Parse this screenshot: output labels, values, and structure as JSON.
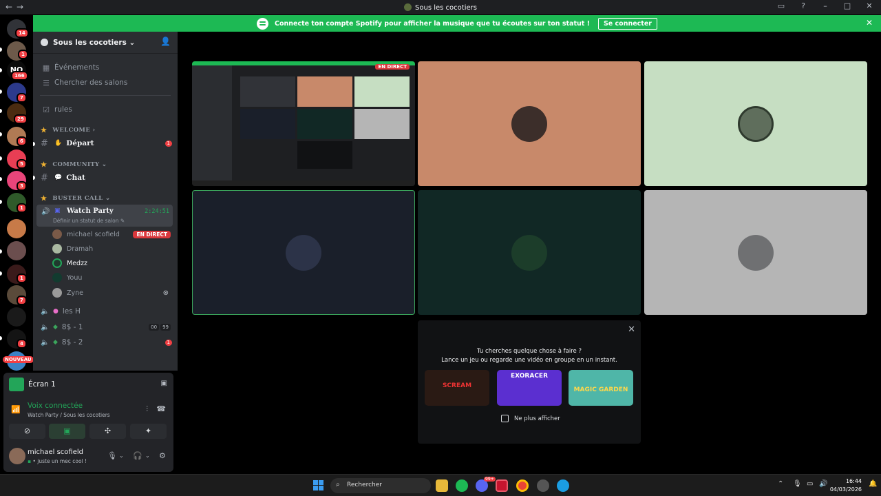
{
  "window": {
    "title": "Sous les cocotiers",
    "nav": "←→"
  },
  "banner": {
    "text": "Connecte ton compte Spotify pour afficher la musique que tu écoutes sur ton statut !",
    "button": "Se connecter"
  },
  "guild_badges": {
    "discord_home": "14",
    "g1": "1",
    "nq_label": "NQ",
    "nq": "166",
    "g3": "7",
    "g4": "29",
    "g5": "6",
    "g6": "5",
    "g7": "3",
    "g8": "1",
    "g10": "1",
    "g11": "7",
    "g13": "4",
    "new": "NOUVEAU"
  },
  "server": {
    "name": "Sous les cocotiers"
  },
  "sidebar": {
    "events": "Événements",
    "browse": "Chercher des salons",
    "rules": "rules",
    "cat_welcome": "WELCOME",
    "depart": "Départ",
    "depart_badge": "1",
    "cat_community": "COMMUNITY",
    "chat": "Chat",
    "cat_buster": "BUSTER CALL",
    "watch_party": "Watch Party",
    "watch_time": "2:24:51",
    "watch_status": "Définir un statut de salon",
    "members": [
      "michael scofield",
      "Dramah",
      "Medzz",
      "Youu",
      "Zyne"
    ],
    "live_label": "EN DIRECT",
    "les_h": "les H",
    "eight1": "8$ - 1",
    "eight1_tags": [
      "00",
      "99"
    ],
    "eight2": "8$ - 2",
    "eight2_badge": "1"
  },
  "panel": {
    "screen": "Écran 1",
    "voice_connected": "Voix connectée",
    "voice_sub_channel": "Watch Party",
    "voice_sub_server": " / Sous les cocotiers",
    "username": "michael scofield",
    "status": "juste un mec cool !"
  },
  "stage": {
    "live_label": "EN DIRECT",
    "suggest_q1": "Tu cherches quelque chose à faire ?",
    "suggest_q2": "Lance un jeu ou regarde une vidéo en groupe en un instant.",
    "games": [
      "SCREAM",
      "EXORACER",
      "MAGIC GARDEN"
    ],
    "dont_show": "Ne plus afficher"
  },
  "taskbar": {
    "search": "Rechercher",
    "time": "16:44",
    "date": "04/03/2026",
    "discord_badge": "99+"
  },
  "colors": {
    "spotify": "#1db954",
    "voice_green": "#23a559",
    "danger": "#da373c"
  }
}
